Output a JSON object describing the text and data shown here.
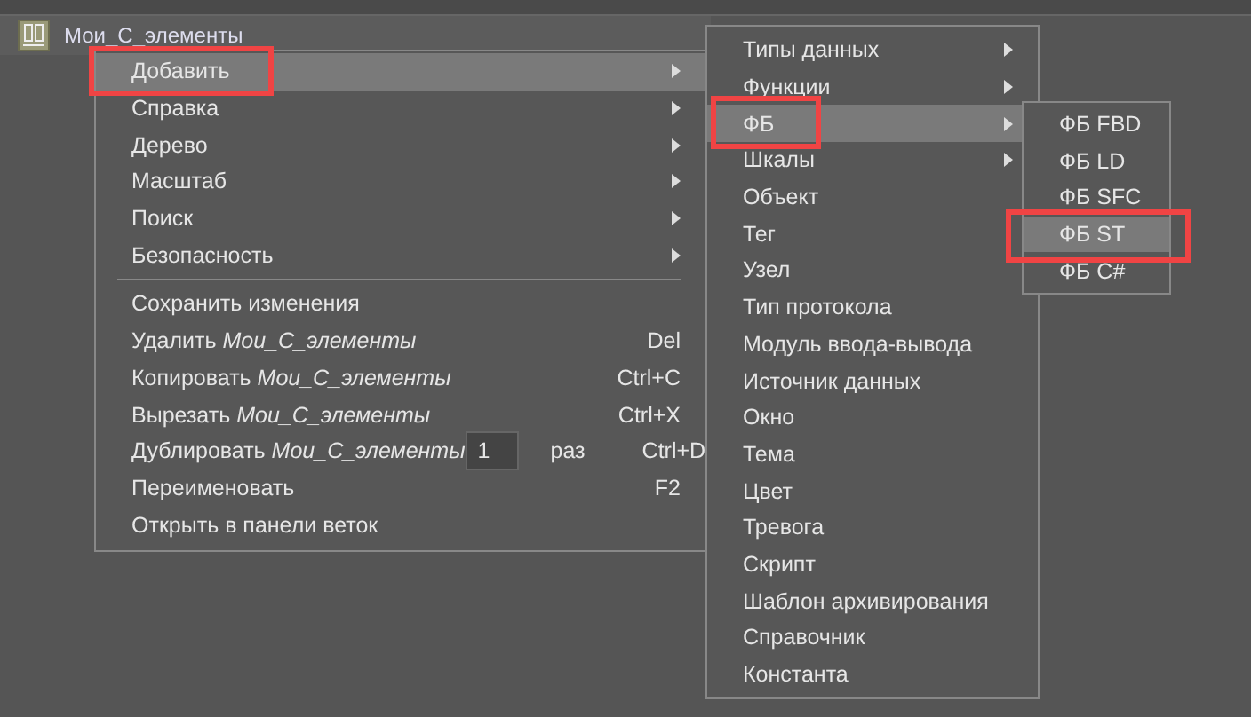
{
  "tree": {
    "label": "Мои_С_элементы"
  },
  "context_menu": {
    "items": [
      {
        "kind": "submenu",
        "label": "Добавить",
        "selected": true,
        "annotated": true
      },
      {
        "kind": "submenu",
        "label": "Справка",
        "selected": false,
        "annotated": false
      },
      {
        "kind": "submenu",
        "label": "Дерево",
        "selected": false,
        "annotated": false
      },
      {
        "kind": "submenu",
        "label": "Масштаб",
        "selected": false,
        "annotated": false
      },
      {
        "kind": "submenu",
        "label": "Поиск",
        "selected": false,
        "annotated": false
      },
      {
        "kind": "submenu",
        "label": "Безопасность",
        "selected": false,
        "annotated": false
      },
      {
        "kind": "separator"
      },
      {
        "kind": "action",
        "label": "Сохранить изменения"
      },
      {
        "kind": "action",
        "label": "Удалить *Мои_С_элементы*",
        "shortcut": "Del"
      },
      {
        "kind": "action",
        "label": "Копировать *Мои_С_элементы*",
        "shortcut": "Ctrl+C"
      },
      {
        "kind": "action",
        "label": "Вырезать *Мои_С_элементы*",
        "shortcut": "Ctrl+X"
      },
      {
        "kind": "count",
        "label": "Дублировать *Мои_С_элементы*",
        "value": "1",
        "unit": "раз",
        "shortcut": "Ctrl+D"
      },
      {
        "kind": "action",
        "label": "Переименовать",
        "shortcut": "F2"
      },
      {
        "kind": "action",
        "label": "Открыть в панели веток"
      }
    ]
  },
  "add_submenu": {
    "items": [
      {
        "label": "Типы данных",
        "has_submenu": true,
        "selected": false,
        "annotated": false
      },
      {
        "label": "Функции",
        "has_submenu": true,
        "selected": false,
        "annotated": false
      },
      {
        "label": "ФБ",
        "has_submenu": true,
        "selected": true,
        "annotated": true
      },
      {
        "label": "Шкалы",
        "has_submenu": true,
        "selected": false,
        "annotated": false
      },
      {
        "label": "Объект",
        "has_submenu": false,
        "selected": false,
        "annotated": false
      },
      {
        "label": "Тег",
        "has_submenu": false,
        "selected": false,
        "annotated": false
      },
      {
        "label": "Узел",
        "has_submenu": false,
        "selected": false,
        "annotated": false
      },
      {
        "label": "Тип протокола",
        "has_submenu": false,
        "selected": false,
        "annotated": false
      },
      {
        "label": "Модуль ввода-вывода",
        "has_submenu": false,
        "selected": false,
        "annotated": false
      },
      {
        "label": "Источник данных",
        "has_submenu": false,
        "selected": false,
        "annotated": false
      },
      {
        "label": "Окно",
        "has_submenu": false,
        "selected": false,
        "annotated": false
      },
      {
        "label": "Тема",
        "has_submenu": false,
        "selected": false,
        "annotated": false
      },
      {
        "label": "Цвет",
        "has_submenu": false,
        "selected": false,
        "annotated": false
      },
      {
        "label": "Тревога",
        "has_submenu": false,
        "selected": false,
        "annotated": false
      },
      {
        "label": "Скрипт",
        "has_submenu": false,
        "selected": false,
        "annotated": false
      },
      {
        "label": "Шаблон архивирования",
        "has_submenu": false,
        "selected": false,
        "annotated": false
      },
      {
        "label": "Справочник",
        "has_submenu": false,
        "selected": false,
        "annotated": false
      },
      {
        "label": "Константа",
        "has_submenu": false,
        "selected": false,
        "annotated": false
      }
    ]
  },
  "fb_submenu": {
    "items": [
      {
        "label": "ФБ FBD",
        "selected": false,
        "annotated": false
      },
      {
        "label": "ФБ LD",
        "selected": false,
        "annotated": false
      },
      {
        "label": "ФБ SFC",
        "selected": false,
        "annotated": false
      },
      {
        "label": "ФБ ST",
        "selected": true,
        "annotated": true
      },
      {
        "label": "ФБ C#",
        "selected": false,
        "annotated": false
      }
    ]
  }
}
